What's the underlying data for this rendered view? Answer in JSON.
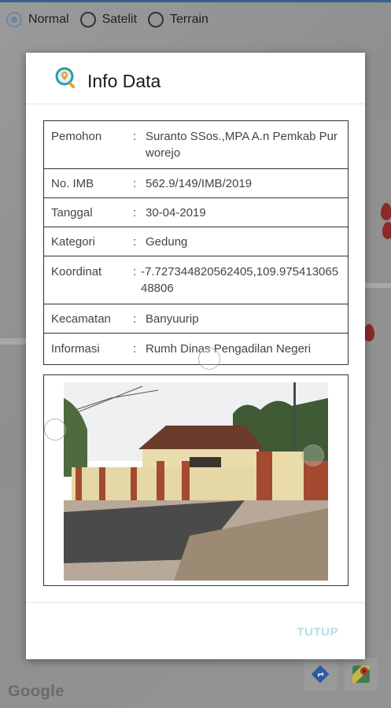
{
  "map_type": {
    "options": [
      "Normal",
      "Satelit",
      "Terrain"
    ],
    "selected": "Normal"
  },
  "google_logo": "Google",
  "map_controls": {
    "directions_icon": "directions-icon",
    "maps_icon": "google-maps-icon"
  },
  "dialog": {
    "title": "Info Data",
    "icon": "search-location-icon",
    "rows": [
      {
        "label": "Pemohon",
        "value": "Suranto SSos.,MPA A.n Pemkab Purworejo"
      },
      {
        "label": "No. IMB",
        "value": "562.9/149/IMB/2019"
      },
      {
        "label": "Tanggal",
        "value": "30-04-2019"
      },
      {
        "label": "Kategori",
        "value": "Gedung"
      },
      {
        "label": "Koordinat",
        "value": "-7.727344820562405,109.97541306548806"
      },
      {
        "label": "Kecamatan",
        "value": "Banyuurip"
      },
      {
        "label": "Informasi",
        "value": "Rumh Dinas Pengadilan Negeri"
      }
    ],
    "colon": ":",
    "photo_alt": "building-photo",
    "close_button": "TUTUP"
  },
  "colors": {
    "accent": "#6e86a8",
    "button_text": "#b9dde3",
    "divider": "#e6f4f6"
  }
}
